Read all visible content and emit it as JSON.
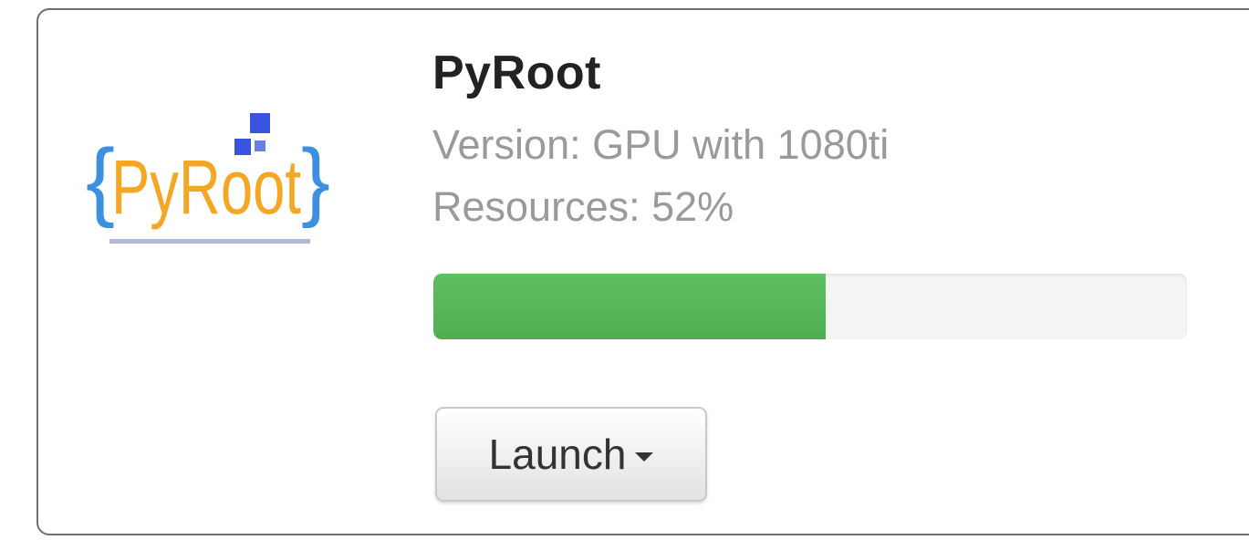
{
  "app": {
    "name": "PyRoot",
    "logo_text": "PyRoot",
    "version": "Version: GPU with 1080ti",
    "resources": "Resources: 52%",
    "resources_percent": 52
  },
  "actions": {
    "launch_label": "Launch",
    "launch_icon": "caret-down-icon"
  },
  "colors": {
    "progress_fill": "#5cb85c",
    "logo_brace": "#3d8fe0",
    "logo_text": "#f5a623",
    "logo_squares": "#3a54e0"
  }
}
